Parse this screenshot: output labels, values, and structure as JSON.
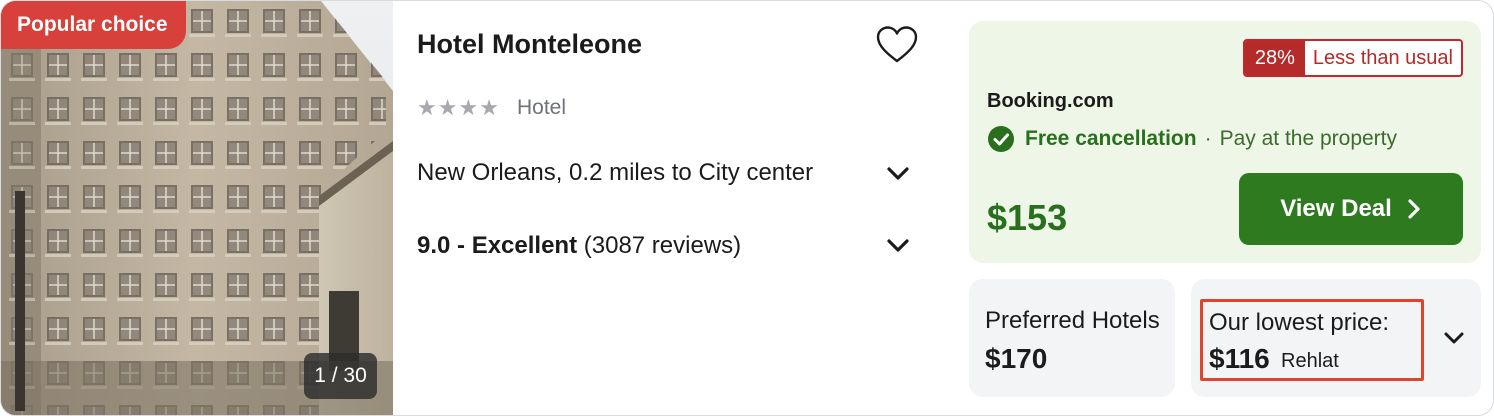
{
  "photo": {
    "badge": "Popular choice",
    "counter": "1 / 30"
  },
  "hotel": {
    "name": "Hotel Monteleone",
    "stars": 4,
    "type": "Hotel",
    "location": "New Orleans, 0.2 miles to City center",
    "rating_label": "9.0 - Excellent",
    "reviews": "(3087 reviews)"
  },
  "deal": {
    "discount_pct": "28%",
    "discount_text": "Less than usual",
    "provider": "Booking.com",
    "free_cancellation": "Free cancellation",
    "separator": "·",
    "pay_option": "Pay at the property",
    "price": "$153",
    "button_label": "View Deal"
  },
  "other_offers": [
    {
      "name": "Preferred Hotels",
      "price": "$170"
    },
    {
      "label": "Our lowest price:",
      "price": "$116",
      "provider": "Rehlat"
    }
  ],
  "colors": {
    "badge": "#d8403c",
    "deal_bg": "#eef6e8",
    "green_text": "#2a6f1e",
    "button": "#2d7a1f",
    "discount": "#b52b2a",
    "highlight": "#e0452b"
  }
}
